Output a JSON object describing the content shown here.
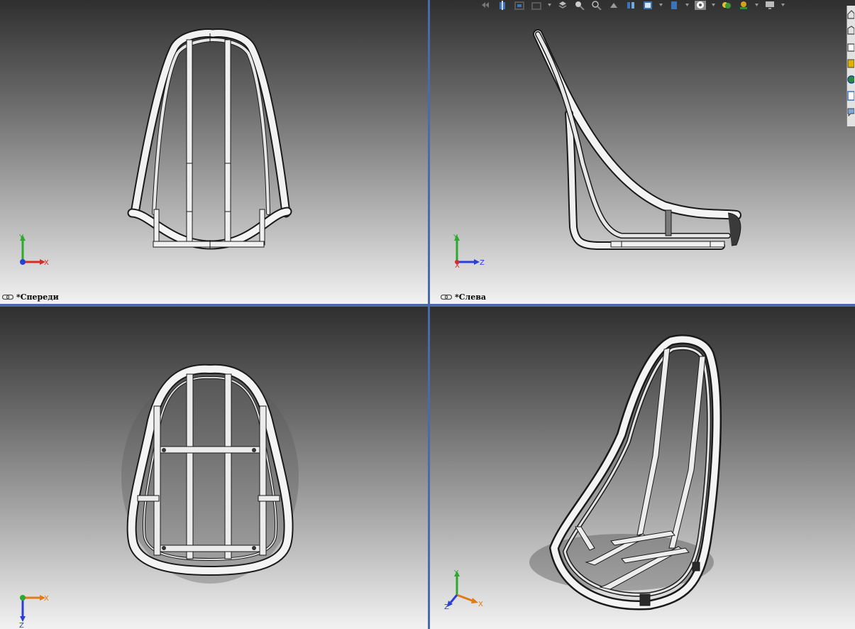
{
  "viewports": {
    "front": {
      "label": "*Спереди"
    },
    "left": {
      "label": "*Слева"
    },
    "top": {
      "label": ""
    },
    "iso": {
      "label": ""
    }
  },
  "axes": {
    "x": "X",
    "y": "Y",
    "z": "Z"
  },
  "colors": {
    "divider": "#4a6aa8",
    "axis_x": "#d62b2b",
    "axis_y": "#2ea82e",
    "axis_z": "#2b3fd6",
    "axis_x_iso": "#e07b1a",
    "frame_tube": "#f4f4f4",
    "frame_edge": "#1a1a1a"
  },
  "toolbar_icons": [
    "previous-view-icon",
    "section-view-icon",
    "view-orientation-icon",
    "display-style-icon",
    "hide-show-icon",
    "edit-appearance-icon",
    "apply-scene-icon",
    "view-settings-icon",
    "zoom-to-fit-icon",
    "zoom-area-icon",
    "rotate-icon",
    "standard-views-icon",
    "render-tools-icon",
    "scene-icon",
    "appearance-icon",
    "monitor-icon"
  ],
  "task_pane_icons": [
    "home-icon",
    "design-library-icon",
    "file-explorer-icon",
    "view-palette-icon",
    "appearances-icon",
    "custom-properties-icon",
    "forum-icon"
  ]
}
